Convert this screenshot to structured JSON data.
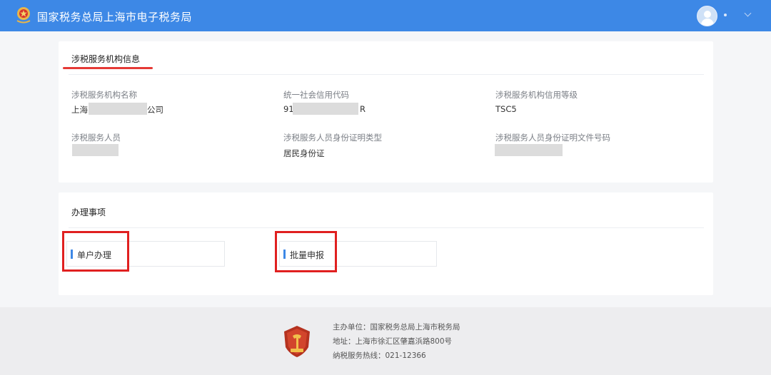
{
  "header": {
    "title": "国家税务总局上海市电子税务局",
    "emblem_icon": "tax-emblem-icon",
    "avatar_icon": "user-avatar-icon",
    "accent_color": "#3d88e6"
  },
  "org_info": {
    "title": "涉税服务机构信息",
    "fields": {
      "name": {
        "label": "涉税服务机构名称",
        "value_prefix": "上海",
        "value_suffix": "公司"
      },
      "credit_code": {
        "label": "统一社会信用代码",
        "value_prefix": "91",
        "value_suffix": "R"
      },
      "credit_level": {
        "label": "涉税服务机构信用等级",
        "value": "TSC5"
      },
      "staff": {
        "label": "涉税服务人员"
      },
      "id_type": {
        "label": "涉税服务人员身份证明类型",
        "value": "居民身份证"
      },
      "id_number": {
        "label": "涉税服务人员身份证明文件号码"
      }
    }
  },
  "tasks": {
    "title": "办理事项",
    "items": [
      {
        "label": "单户办理"
      },
      {
        "label": "批量申报"
      }
    ]
  },
  "footer": {
    "logo_icon": "tax-bureau-logo-icon",
    "host": "主办单位：国家税务总局上海市税务局",
    "address": "地址：上海市徐汇区肇嘉浜路800号",
    "hotline": "纳税服务热线：021-12366"
  }
}
